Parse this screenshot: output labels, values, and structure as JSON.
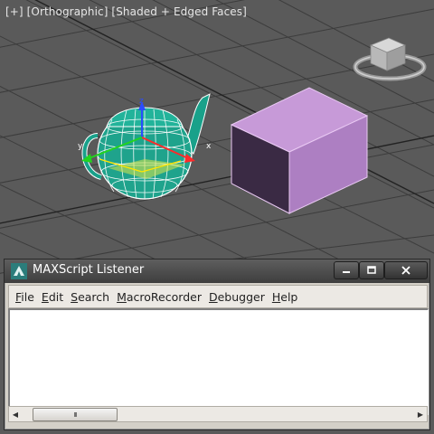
{
  "viewport": {
    "label_prefix": "[+]",
    "view_mode": "[Orthographic]",
    "shading_mode": "[Shaded + Edged Faces]",
    "colors": {
      "background": "#5a5a5a",
      "grid": "#3a3a3a",
      "teapot": "#1fa08a",
      "box": "#b07ec4"
    }
  },
  "listener": {
    "title": "MAXScript Listener",
    "menu": [
      "File",
      "Edit",
      "Search",
      "MacroRecorder",
      "Debugger",
      "Help"
    ],
    "output_text": "",
    "scroll_thumb_grip": "III"
  },
  "gizmo": {
    "x_axis": "x",
    "y_axis": "y",
    "z_axis": "z"
  }
}
